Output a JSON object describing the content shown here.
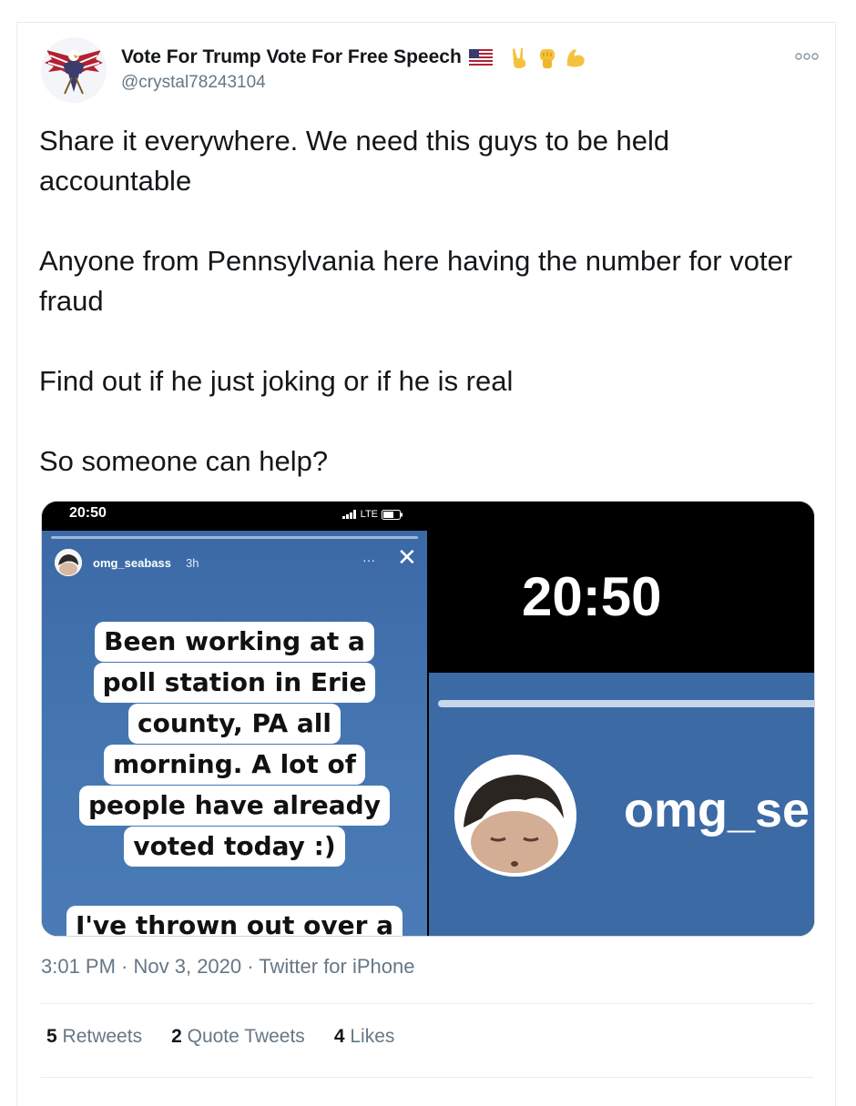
{
  "author": {
    "display_name": "Vote For Trump Vote For Free Speech",
    "handle": "@crystal78243104",
    "emojis": [
      "us-flag-icon",
      "victory-hand-icon",
      "raised-fist-icon",
      "flexed-biceps-icon"
    ]
  },
  "tweet": {
    "paragraphs": [
      "Share it everywhere. We need this guys to be held accountable",
      "Anyone from Pennsylvania here having the number for voter fraud",
      "Find out if he just joking or if he is real",
      "So someone can help?"
    ]
  },
  "media": {
    "left": {
      "status_time": "20:50",
      "network": "LTE",
      "story_user": "omg_seabass",
      "story_age": "3h",
      "story_more": "···",
      "story_close": "✕",
      "caption_lines": [
        "Been working at a",
        "poll station in Erie",
        "county, PA all",
        "morning. A lot of",
        "people have already",
        "voted today :)"
      ],
      "caption_cut": "I've thrown out over a"
    },
    "right": {
      "status_time": "20:50",
      "story_user": "omg_se"
    }
  },
  "meta": {
    "time": "3:01 PM",
    "sep1": " · ",
    "date": "Nov 3, 2020",
    "sep2": " · ",
    "source": "Twitter for iPhone"
  },
  "stats": {
    "retweets_count": "5",
    "retweets_label": "Retweets",
    "quotes_count": "2",
    "quotes_label": "Quote Tweets",
    "likes_count": "4",
    "likes_label": "Likes"
  },
  "colors": {
    "text": "#14171a",
    "secondary": "#657786",
    "border": "#e6ecf0",
    "story_blue": "#4576b1"
  }
}
